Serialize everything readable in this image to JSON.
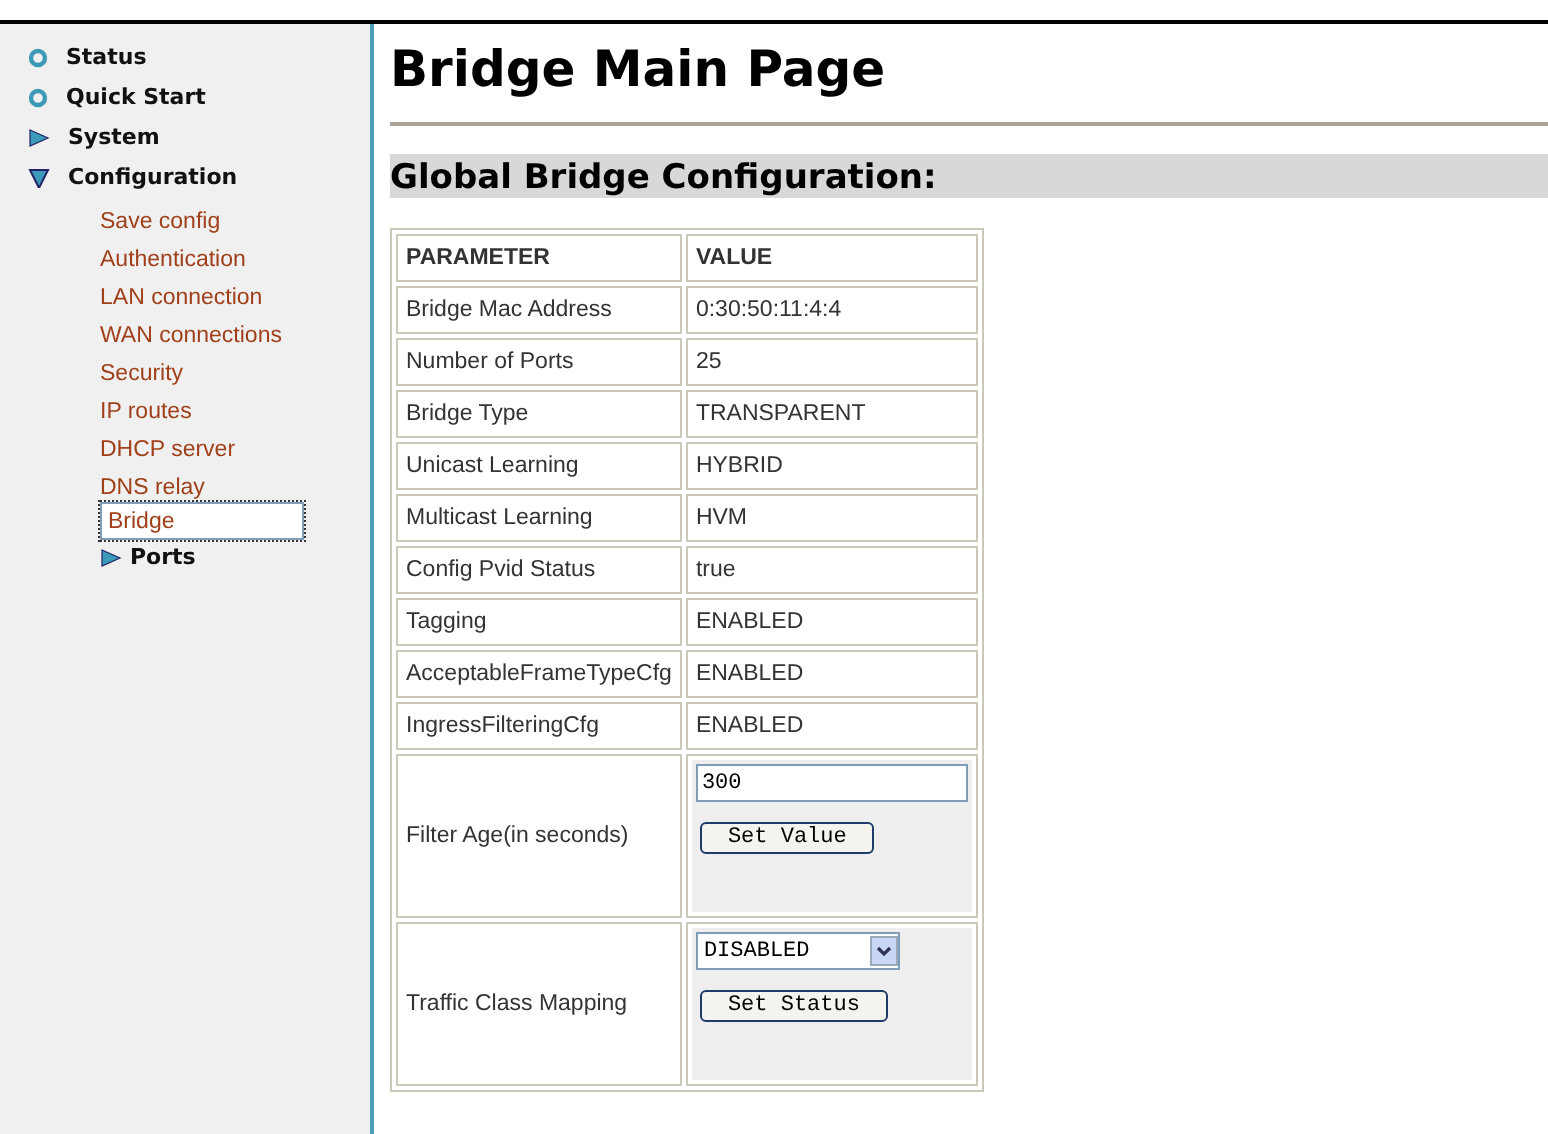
{
  "nav": [
    {
      "label": "Status",
      "kind": "bullet"
    },
    {
      "label": "Quick Start",
      "kind": "bullet"
    },
    {
      "label": "System",
      "kind": "branch",
      "expanded": false
    },
    {
      "label": "Configuration",
      "kind": "branch",
      "expanded": true,
      "children": [
        {
          "label": "Save config",
          "kind": "link",
          "selected": false
        },
        {
          "label": "Authentication",
          "kind": "link",
          "selected": false
        },
        {
          "label": "LAN connection",
          "kind": "link",
          "selected": false
        },
        {
          "label": "WAN connections",
          "kind": "link",
          "selected": false
        },
        {
          "label": "Security",
          "kind": "link",
          "selected": false
        },
        {
          "label": "IP routes",
          "kind": "link",
          "selected": false
        },
        {
          "label": "DHCP server",
          "kind": "link",
          "selected": false
        },
        {
          "label": "DNS relay",
          "kind": "link",
          "selected": false
        },
        {
          "label": "Bridge",
          "kind": "link",
          "selected": true
        },
        {
          "label": "Ports",
          "kind": "branch",
          "expanded": false
        }
      ]
    }
  ],
  "title": "Bridge Main Page",
  "section": "Global Bridge Configuration:",
  "table": {
    "columns": [
      "PARAMETER",
      "VALUE"
    ],
    "rows": [
      {
        "kind": "text",
        "parameter": "Bridge Mac Address",
        "value": "0:30:50:11:4:4"
      },
      {
        "kind": "text",
        "parameter": "Number of Ports",
        "value": "25"
      },
      {
        "kind": "text",
        "parameter": "Bridge Type",
        "value": "TRANSPARENT"
      },
      {
        "kind": "text",
        "parameter": "Unicast Learning",
        "value": "HYBRID"
      },
      {
        "kind": "text",
        "parameter": "Multicast Learning",
        "value": "HVM"
      },
      {
        "kind": "text",
        "parameter": "Config Pvid Status",
        "value": "true"
      },
      {
        "kind": "text",
        "parameter": "Tagging",
        "value": "ENABLED"
      },
      {
        "kind": "text",
        "parameter": "AcceptableFrameTypeCfg",
        "value": "ENABLED"
      },
      {
        "kind": "text",
        "parameter": "IngressFilteringCfg",
        "value": "ENABLED"
      },
      {
        "kind": "input",
        "parameter": "Filter Age(in seconds)",
        "value": "300",
        "button": "Set Value"
      },
      {
        "kind": "select",
        "parameter": "Traffic Class Mapping",
        "value": "DISABLED",
        "button": "Set Status"
      }
    ]
  }
}
